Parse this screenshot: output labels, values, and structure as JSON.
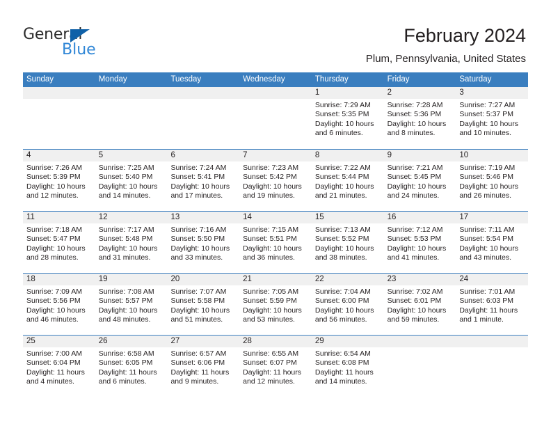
{
  "brand": {
    "name_dark": "General",
    "name_blue": "Blue",
    "triangle_color": "#1061a8",
    "blue_color": "#2f86d6"
  },
  "header": {
    "title": "February 2024",
    "subtitle": "Plum, Pennsylvania, United States"
  },
  "theme": {
    "header_bar": "#3a7ebf",
    "daynum_band": "#f0f0f0",
    "text": "#231f20"
  },
  "weekdays": [
    "Sunday",
    "Monday",
    "Tuesday",
    "Wednesday",
    "Thursday",
    "Friday",
    "Saturday"
  ],
  "weeks": [
    [
      {
        "day": "",
        "sunrise": "",
        "sunset": "",
        "daylight1": "",
        "daylight2": ""
      },
      {
        "day": "",
        "sunrise": "",
        "sunset": "",
        "daylight1": "",
        "daylight2": ""
      },
      {
        "day": "",
        "sunrise": "",
        "sunset": "",
        "daylight1": "",
        "daylight2": ""
      },
      {
        "day": "",
        "sunrise": "",
        "sunset": "",
        "daylight1": "",
        "daylight2": ""
      },
      {
        "day": "1",
        "sunrise": "Sunrise: 7:29 AM",
        "sunset": "Sunset: 5:35 PM",
        "daylight1": "Daylight: 10 hours",
        "daylight2": "and 6 minutes."
      },
      {
        "day": "2",
        "sunrise": "Sunrise: 7:28 AM",
        "sunset": "Sunset: 5:36 PM",
        "daylight1": "Daylight: 10 hours",
        "daylight2": "and 8 minutes."
      },
      {
        "day": "3",
        "sunrise": "Sunrise: 7:27 AM",
        "sunset": "Sunset: 5:37 PM",
        "daylight1": "Daylight: 10 hours",
        "daylight2": "and 10 minutes."
      }
    ],
    [
      {
        "day": "4",
        "sunrise": "Sunrise: 7:26 AM",
        "sunset": "Sunset: 5:39 PM",
        "daylight1": "Daylight: 10 hours",
        "daylight2": "and 12 minutes."
      },
      {
        "day": "5",
        "sunrise": "Sunrise: 7:25 AM",
        "sunset": "Sunset: 5:40 PM",
        "daylight1": "Daylight: 10 hours",
        "daylight2": "and 14 minutes."
      },
      {
        "day": "6",
        "sunrise": "Sunrise: 7:24 AM",
        "sunset": "Sunset: 5:41 PM",
        "daylight1": "Daylight: 10 hours",
        "daylight2": "and 17 minutes."
      },
      {
        "day": "7",
        "sunrise": "Sunrise: 7:23 AM",
        "sunset": "Sunset: 5:42 PM",
        "daylight1": "Daylight: 10 hours",
        "daylight2": "and 19 minutes."
      },
      {
        "day": "8",
        "sunrise": "Sunrise: 7:22 AM",
        "sunset": "Sunset: 5:44 PM",
        "daylight1": "Daylight: 10 hours",
        "daylight2": "and 21 minutes."
      },
      {
        "day": "9",
        "sunrise": "Sunrise: 7:21 AM",
        "sunset": "Sunset: 5:45 PM",
        "daylight1": "Daylight: 10 hours",
        "daylight2": "and 24 minutes."
      },
      {
        "day": "10",
        "sunrise": "Sunrise: 7:19 AM",
        "sunset": "Sunset: 5:46 PM",
        "daylight1": "Daylight: 10 hours",
        "daylight2": "and 26 minutes."
      }
    ],
    [
      {
        "day": "11",
        "sunrise": "Sunrise: 7:18 AM",
        "sunset": "Sunset: 5:47 PM",
        "daylight1": "Daylight: 10 hours",
        "daylight2": "and 28 minutes."
      },
      {
        "day": "12",
        "sunrise": "Sunrise: 7:17 AM",
        "sunset": "Sunset: 5:48 PM",
        "daylight1": "Daylight: 10 hours",
        "daylight2": "and 31 minutes."
      },
      {
        "day": "13",
        "sunrise": "Sunrise: 7:16 AM",
        "sunset": "Sunset: 5:50 PM",
        "daylight1": "Daylight: 10 hours",
        "daylight2": "and 33 minutes."
      },
      {
        "day": "14",
        "sunrise": "Sunrise: 7:15 AM",
        "sunset": "Sunset: 5:51 PM",
        "daylight1": "Daylight: 10 hours",
        "daylight2": "and 36 minutes."
      },
      {
        "day": "15",
        "sunrise": "Sunrise: 7:13 AM",
        "sunset": "Sunset: 5:52 PM",
        "daylight1": "Daylight: 10 hours",
        "daylight2": "and 38 minutes."
      },
      {
        "day": "16",
        "sunrise": "Sunrise: 7:12 AM",
        "sunset": "Sunset: 5:53 PM",
        "daylight1": "Daylight: 10 hours",
        "daylight2": "and 41 minutes."
      },
      {
        "day": "17",
        "sunrise": "Sunrise: 7:11 AM",
        "sunset": "Sunset: 5:54 PM",
        "daylight1": "Daylight: 10 hours",
        "daylight2": "and 43 minutes."
      }
    ],
    [
      {
        "day": "18",
        "sunrise": "Sunrise: 7:09 AM",
        "sunset": "Sunset: 5:56 PM",
        "daylight1": "Daylight: 10 hours",
        "daylight2": "and 46 minutes."
      },
      {
        "day": "19",
        "sunrise": "Sunrise: 7:08 AM",
        "sunset": "Sunset: 5:57 PM",
        "daylight1": "Daylight: 10 hours",
        "daylight2": "and 48 minutes."
      },
      {
        "day": "20",
        "sunrise": "Sunrise: 7:07 AM",
        "sunset": "Sunset: 5:58 PM",
        "daylight1": "Daylight: 10 hours",
        "daylight2": "and 51 minutes."
      },
      {
        "day": "21",
        "sunrise": "Sunrise: 7:05 AM",
        "sunset": "Sunset: 5:59 PM",
        "daylight1": "Daylight: 10 hours",
        "daylight2": "and 53 minutes."
      },
      {
        "day": "22",
        "sunrise": "Sunrise: 7:04 AM",
        "sunset": "Sunset: 6:00 PM",
        "daylight1": "Daylight: 10 hours",
        "daylight2": "and 56 minutes."
      },
      {
        "day": "23",
        "sunrise": "Sunrise: 7:02 AM",
        "sunset": "Sunset: 6:01 PM",
        "daylight1": "Daylight: 10 hours",
        "daylight2": "and 59 minutes."
      },
      {
        "day": "24",
        "sunrise": "Sunrise: 7:01 AM",
        "sunset": "Sunset: 6:03 PM",
        "daylight1": "Daylight: 11 hours",
        "daylight2": "and 1 minute."
      }
    ],
    [
      {
        "day": "25",
        "sunrise": "Sunrise: 7:00 AM",
        "sunset": "Sunset: 6:04 PM",
        "daylight1": "Daylight: 11 hours",
        "daylight2": "and 4 minutes."
      },
      {
        "day": "26",
        "sunrise": "Sunrise: 6:58 AM",
        "sunset": "Sunset: 6:05 PM",
        "daylight1": "Daylight: 11 hours",
        "daylight2": "and 6 minutes."
      },
      {
        "day": "27",
        "sunrise": "Sunrise: 6:57 AM",
        "sunset": "Sunset: 6:06 PM",
        "daylight1": "Daylight: 11 hours",
        "daylight2": "and 9 minutes."
      },
      {
        "day": "28",
        "sunrise": "Sunrise: 6:55 AM",
        "sunset": "Sunset: 6:07 PM",
        "daylight1": "Daylight: 11 hours",
        "daylight2": "and 12 minutes."
      },
      {
        "day": "29",
        "sunrise": "Sunrise: 6:54 AM",
        "sunset": "Sunset: 6:08 PM",
        "daylight1": "Daylight: 11 hours",
        "daylight2": "and 14 minutes."
      },
      {
        "day": "",
        "sunrise": "",
        "sunset": "",
        "daylight1": "",
        "daylight2": ""
      },
      {
        "day": "",
        "sunrise": "",
        "sunset": "",
        "daylight1": "",
        "daylight2": ""
      }
    ]
  ]
}
